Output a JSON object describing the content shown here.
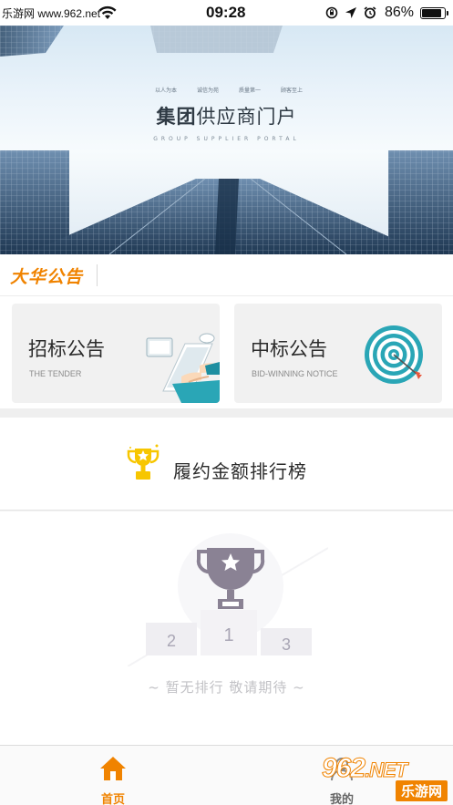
{
  "status_bar": {
    "watermark": "乐游网 www.962.net",
    "time": "09:28",
    "battery_pct": "86%",
    "battery_level": 0.86,
    "icons": [
      "wifi-icon",
      "rotation-lock-icon",
      "location-icon",
      "alarm-icon",
      "battery-icon"
    ]
  },
  "banner": {
    "tags": [
      "以人为本",
      "诚信为苑",
      "质量第一",
      "顾客至上"
    ],
    "title_bold": "集团",
    "title_rest": "供应商门户",
    "subtitle": "GROUP SUPPLIER PORTAL"
  },
  "notice": {
    "logo_text": "大华公告"
  },
  "cards": [
    {
      "title": "招标公告",
      "subtitle": "THE TENDER",
      "icon": "laptop-typing-icon"
    },
    {
      "title": "中标公告",
      "subtitle": "BID-WINNING NOTICE",
      "icon": "target-icon"
    }
  ],
  "ranking": {
    "title": "履约金额排行榜",
    "icon": "trophy-icon",
    "podium": [
      "2",
      "1",
      "3"
    ],
    "empty_text": "~ 暂无排行 敬请期待 ~"
  },
  "tab_bar": {
    "home_label": "首页",
    "mine_label": "我的"
  },
  "watermark": {
    "number": "962",
    "suffix": ".NET",
    "name": "乐游网"
  },
  "colors": {
    "accent": "#f08300",
    "card_bg": "#f1f1f1",
    "teal": "#2aa6b6"
  }
}
